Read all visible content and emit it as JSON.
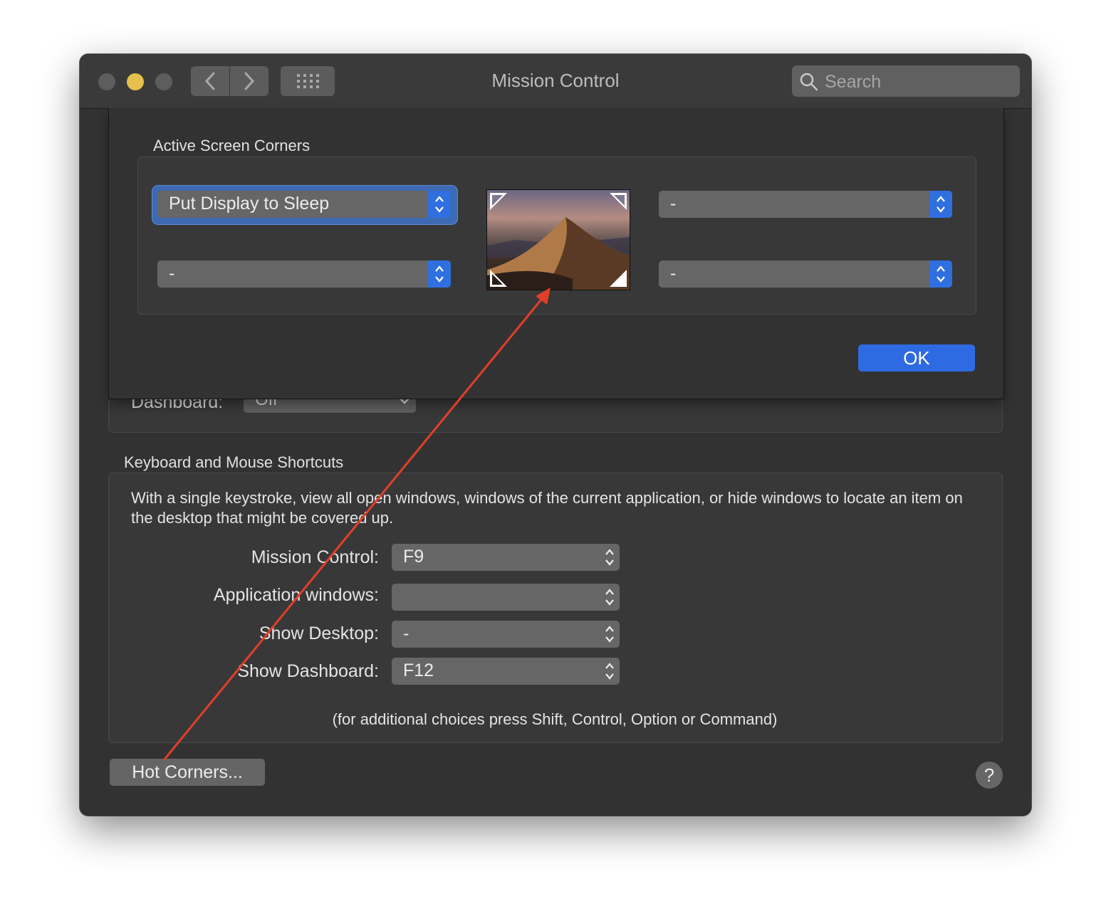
{
  "window": {
    "title": "Mission Control"
  },
  "search": {
    "placeholder": "Search"
  },
  "sheet": {
    "title": "Active Screen Corners",
    "top_left": "Put Display to Sleep",
    "top_right": "-",
    "bottom_left": "-",
    "bottom_right": "-",
    "ok_label": "OK"
  },
  "dashboard": {
    "label": "Dashboard:",
    "value": "Off"
  },
  "shortcuts": {
    "title": "Keyboard and Mouse Shortcuts",
    "description": "With a single keystroke, view all open windows, windows of the current application, or hide windows to locate an item on the desktop that might be covered up.",
    "rows": [
      {
        "label": "Mission Control:",
        "value": "F9"
      },
      {
        "label": "Application windows:",
        "value": ""
      },
      {
        "label": "Show Desktop:",
        "value": "-"
      },
      {
        "label": "Show Dashboard:",
        "value": "F12"
      }
    ],
    "hint": "(for additional choices press Shift, Control, Option or Command)"
  },
  "footer": {
    "hot_corners_label": "Hot Corners...",
    "help_label": "?"
  },
  "colors": {
    "accent": "#2e6ae2",
    "annotation": "#e0402a",
    "window_bg": "#323232"
  }
}
